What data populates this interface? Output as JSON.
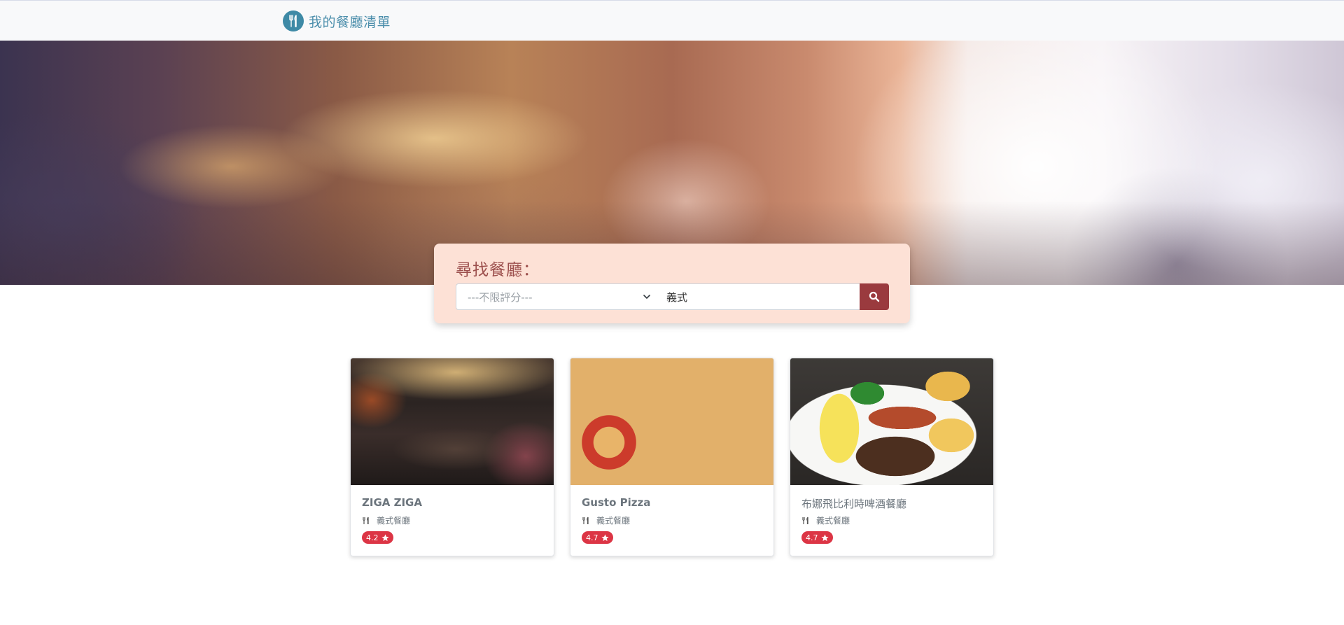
{
  "navbar": {
    "brand_text": "我的餐廳清單",
    "brand_icon": "utensils-icon"
  },
  "search": {
    "title": "尋找餐廳：",
    "rating_select_value": "---不限評分---",
    "keyword_value": "義式",
    "button_icon": "search-icon"
  },
  "restaurants": [
    {
      "name": "ZIGA ZIGA",
      "category": "義式餐廳",
      "rating": "4.2"
    },
    {
      "name": "Gusto Pizza",
      "category": "義式餐廳",
      "rating": "4.7"
    },
    {
      "name": "布娜飛比利時啤酒餐廳",
      "category": "義式餐廳",
      "rating": "4.7"
    }
  ],
  "colors": {
    "brand": "#4b8eab",
    "panel_bg": "#fde1d6",
    "search_button": "#9a3a3e",
    "rating_badge": "#dc3545"
  }
}
